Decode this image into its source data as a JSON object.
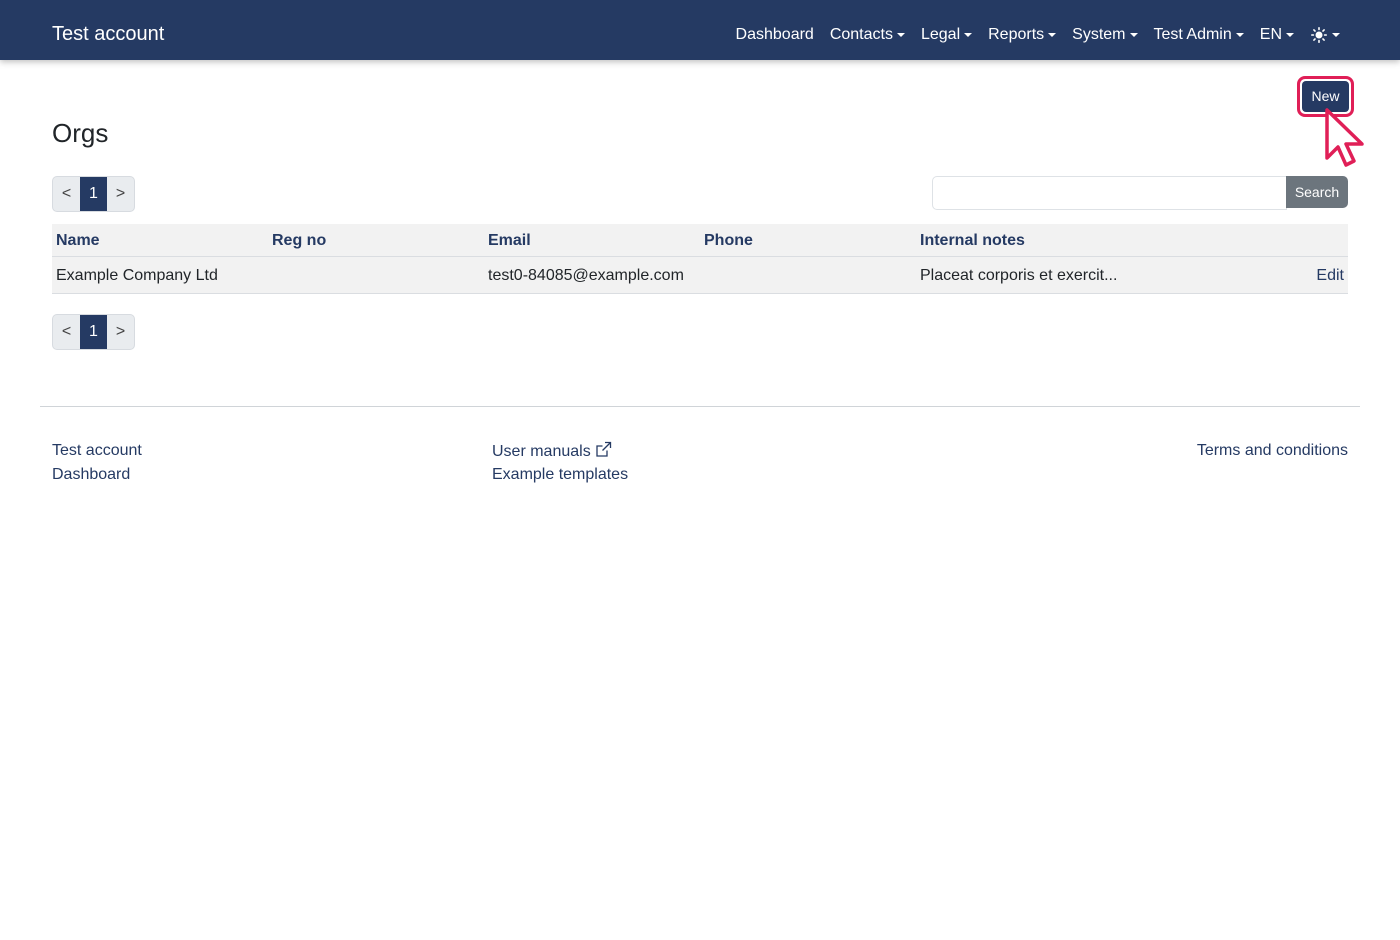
{
  "navbar": {
    "brand": "Test account",
    "items": [
      {
        "label": "Dashboard",
        "dropdown": false
      },
      {
        "label": "Contacts",
        "dropdown": true
      },
      {
        "label": "Legal",
        "dropdown": true
      },
      {
        "label": "Reports",
        "dropdown": true
      },
      {
        "label": "System",
        "dropdown": true
      },
      {
        "label": "Test Admin",
        "dropdown": true
      },
      {
        "label": "EN",
        "dropdown": true
      }
    ],
    "theme_icon": "sun-icon",
    "bg_color": "#253a63"
  },
  "actions": {
    "new_label": "New",
    "highlight_color": "#e01f57"
  },
  "page": {
    "title": "Orgs"
  },
  "pagination": {
    "prev": "<",
    "current": "1",
    "next": ">"
  },
  "search": {
    "value": "",
    "button_label": "Search"
  },
  "table": {
    "headers": [
      "Name",
      "Reg no",
      "Email",
      "Phone",
      "Internal notes"
    ],
    "rows": [
      {
        "name": "Example Company Ltd",
        "reg_no": "",
        "email": "test0-84085@example.com",
        "phone": "",
        "notes": "Placeat corporis et exercit...",
        "action": "Edit"
      }
    ]
  },
  "footer": {
    "col1": [
      "Test account",
      "Dashboard"
    ],
    "col2": [
      "User manuals",
      "Example templates"
    ],
    "col3": [
      "Terms and conditions"
    ],
    "external_icon": "external-link-icon"
  }
}
